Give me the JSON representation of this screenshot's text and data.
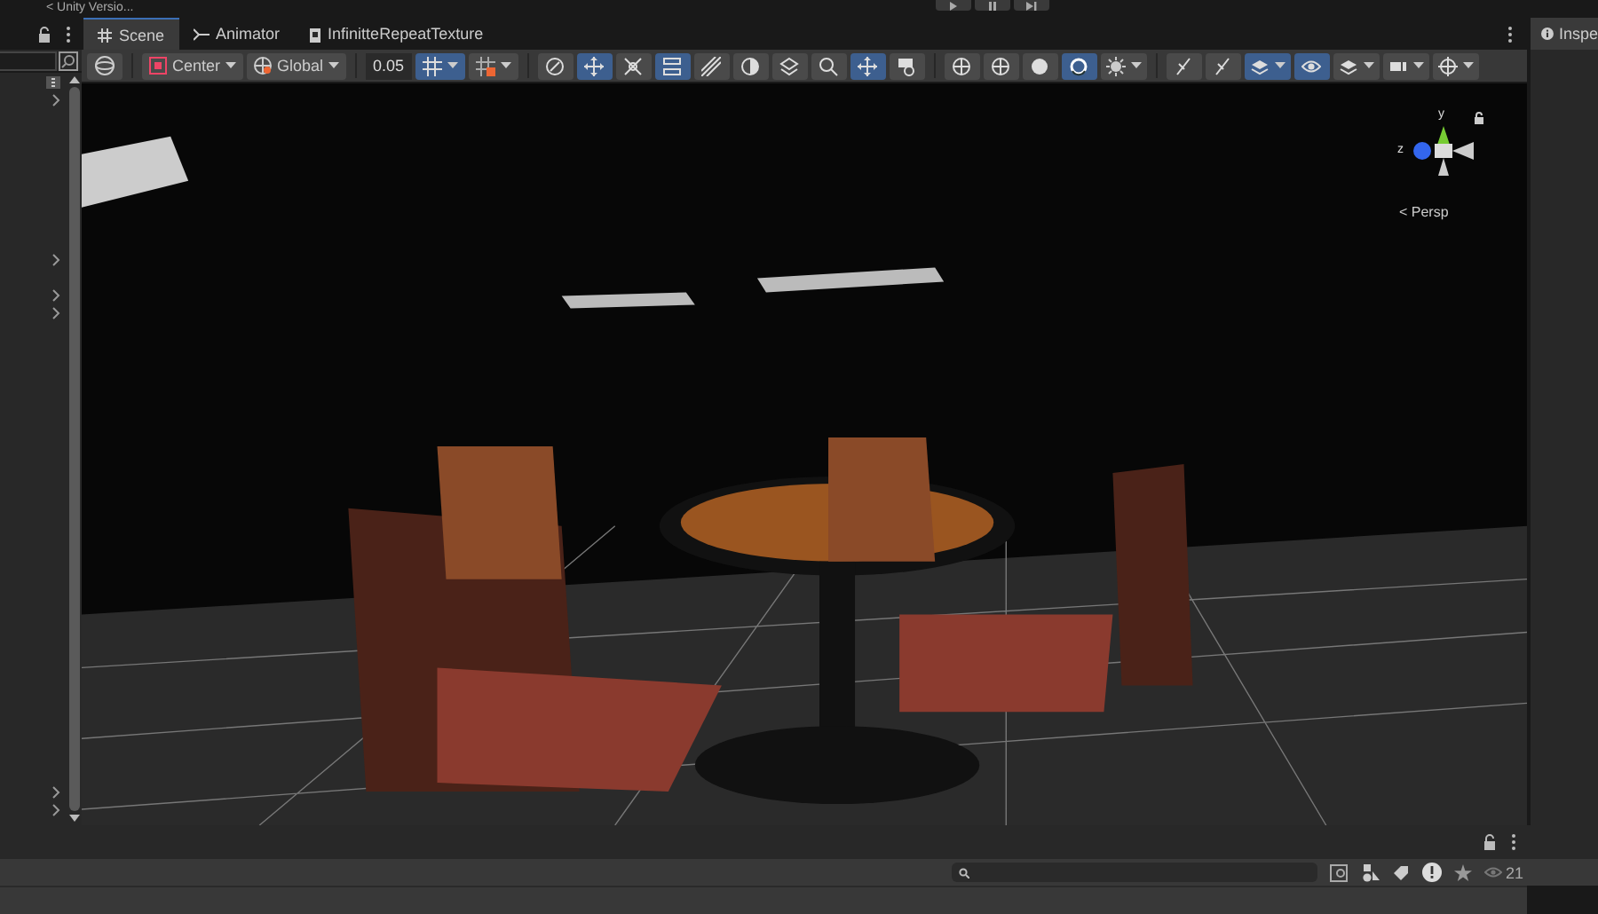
{
  "title_bar": {
    "text": "< Unity Versio..."
  },
  "tabs": [
    {
      "label": "Scene",
      "selected": true
    },
    {
      "label": "Animator",
      "selected": false
    },
    {
      "label": "InfinitteRepeatTexture",
      "selected": false
    }
  ],
  "inspector_tab": {
    "label": "Inspe"
  },
  "toolbar": {
    "pivot": "Center",
    "space": "Global",
    "snap_value": "0.05",
    "tools": [
      {
        "kind": "toggle",
        "on": false
      },
      {
        "kind": "toggle",
        "on": true
      },
      {
        "kind": "toggle",
        "on": false
      },
      {
        "kind": "toggle",
        "on": true
      },
      {
        "kind": "toggle",
        "on": false
      },
      {
        "kind": "toggle",
        "on": false
      },
      {
        "kind": "toggle",
        "on": false
      },
      {
        "kind": "toggle",
        "on": false
      },
      {
        "kind": "toggle",
        "on": true
      },
      {
        "kind": "toggle",
        "on": false
      },
      {
        "kind": "separator"
      },
      {
        "kind": "toggle",
        "on": false
      },
      {
        "kind": "toggle",
        "on": false
      },
      {
        "kind": "toggle",
        "on": false
      },
      {
        "kind": "toggle",
        "on": true
      },
      {
        "kind": "dropdown",
        "on": false
      },
      {
        "kind": "separator"
      },
      {
        "kind": "toggle",
        "on": false
      },
      {
        "kind": "toggle",
        "on": false
      },
      {
        "kind": "dropdown",
        "on": true
      },
      {
        "kind": "toggle",
        "on": true
      },
      {
        "kind": "dropdown",
        "on": false
      },
      {
        "kind": "dropdown",
        "on": false
      },
      {
        "kind": "dropdown",
        "on": false
      }
    ]
  },
  "hierarchy": {
    "rows": [
      {
        "expandable": true
      },
      {
        "expandable": false
      },
      {
        "expandable": false
      },
      {
        "expandable": false
      },
      {
        "expandable": false
      },
      {
        "expandable": false
      },
      {
        "expandable": false
      },
      {
        "expandable": false
      },
      {
        "expandable": false
      },
      {
        "expandable": true
      },
      {
        "expandable": false
      },
      {
        "expandable": true
      },
      {
        "expandable": true
      },
      {
        "expandable": false
      },
      {
        "expandable": false
      },
      {
        "expandable": false
      },
      {
        "expandable": false
      },
      {
        "expandable": false
      },
      {
        "expandable": false
      },
      {
        "expandable": false
      },
      {
        "expandable": false
      },
      {
        "expandable": false
      },
      {
        "expandable": false
      },
      {
        "expandable": false
      },
      {
        "expandable": false
      },
      {
        "expandable": false
      },
      {
        "expandable": false
      },
      {
        "expandable": false
      },
      {
        "expandable": false
      },
      {
        "expandable": false
      },
      {
        "expandable": false
      },
      {
        "expandable": false
      },
      {
        "expandable": false
      },
      {
        "expandable": false
      },
      {
        "expandable": false
      },
      {
        "expandable": false
      },
      {
        "expandable": false
      },
      {
        "expandable": false
      },
      {
        "expandable": false
      },
      {
        "expandable": true
      },
      {
        "expandable": true
      }
    ]
  },
  "gizmo": {
    "y_label": "y",
    "z_label": "z",
    "view_label": "< Persp"
  },
  "project_bar": {
    "hidden_count": "21"
  }
}
